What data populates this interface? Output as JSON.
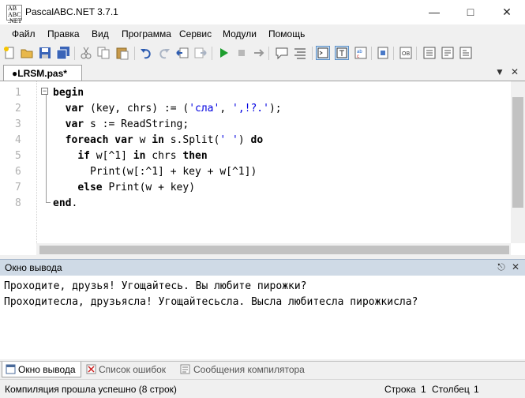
{
  "window": {
    "title": "PascalABC.NET 3.7.1",
    "icon_text": "AB \nABC\n.NET"
  },
  "menu": [
    "Файл",
    "Правка",
    "Вид",
    "Программа",
    "Сервис",
    "Модули",
    "Помощь"
  ],
  "toolbar": {
    "icons": [
      "new-file-icon",
      "open-icon",
      "save-icon",
      "save-all-icon",
      "cut-icon",
      "copy-icon",
      "paste-icon",
      "undo-icon",
      "redo-icon",
      "navigate-back-icon",
      "navigate-forward-icon",
      "run-icon",
      "stop-icon",
      "step-icon",
      "comment-icon",
      "format-icon",
      "console-window-icon",
      "text-window-icon",
      "check-icon",
      "properties-icon",
      "code-template-icon",
      "debug-step-into-icon",
      "debug-step-over-icon",
      "debug-step-out-icon"
    ]
  },
  "tabs": {
    "file_tab": "●LRSM.pas*"
  },
  "editor": {
    "line_numbers": [
      "1",
      "2",
      "3",
      "4",
      "5",
      "6",
      "7",
      "8"
    ],
    "lines": [
      [
        {
          "t": "begin",
          "k": "kw"
        }
      ],
      [
        {
          "t": "  "
        },
        {
          "t": "var",
          "k": "kw"
        },
        {
          "t": " (key, chrs) := ("
        },
        {
          "t": "'сла'",
          "k": "str"
        },
        {
          "t": ", "
        },
        {
          "t": "',!?.'",
          "k": "str"
        },
        {
          "t": ");"
        }
      ],
      [
        {
          "t": "  "
        },
        {
          "t": "var",
          "k": "kw"
        },
        {
          "t": " s := ReadString;"
        }
      ],
      [
        {
          "t": "  "
        },
        {
          "t": "foreach",
          "k": "kw"
        },
        {
          "t": " "
        },
        {
          "t": "var",
          "k": "kw"
        },
        {
          "t": " w "
        },
        {
          "t": "in",
          "k": "kw"
        },
        {
          "t": " s.Split("
        },
        {
          "t": "' '",
          "k": "str"
        },
        {
          "t": ") "
        },
        {
          "t": "do",
          "k": "kw"
        }
      ],
      [
        {
          "t": "    "
        },
        {
          "t": "if",
          "k": "kw"
        },
        {
          "t": " w[^1] "
        },
        {
          "t": "in",
          "k": "kw"
        },
        {
          "t": " chrs "
        },
        {
          "t": "then",
          "k": "kw"
        }
      ],
      [
        {
          "t": "      Print(w[:^1] + key + w[^1])"
        }
      ],
      [
        {
          "t": "    "
        },
        {
          "t": "else",
          "k": "kw"
        },
        {
          "t": " Print(w + key)"
        }
      ],
      [
        {
          "t": "end",
          "k": "kw"
        },
        {
          "t": "."
        }
      ]
    ]
  },
  "output_panel": {
    "title": "Окно вывода",
    "lines": [
      "Проходите, друзья! Угощайтесь. Вы любите пирожки?",
      "Проходитесла, друзьясла! Угощайтесьсла. Высла любитесла пирожкисла?"
    ]
  },
  "bottom_tabs": [
    "Окно вывода",
    "Список ошибок",
    "Сообщения компилятора"
  ],
  "status": {
    "message": "Компиляция прошла успешно (8 строк)",
    "row_label": "Строка",
    "row_value": "1",
    "col_label": "Столбец",
    "col_value": "1"
  },
  "colors": {
    "keyword": "#000000",
    "string": "#0000e0",
    "panel_header": "#cfdae6"
  }
}
